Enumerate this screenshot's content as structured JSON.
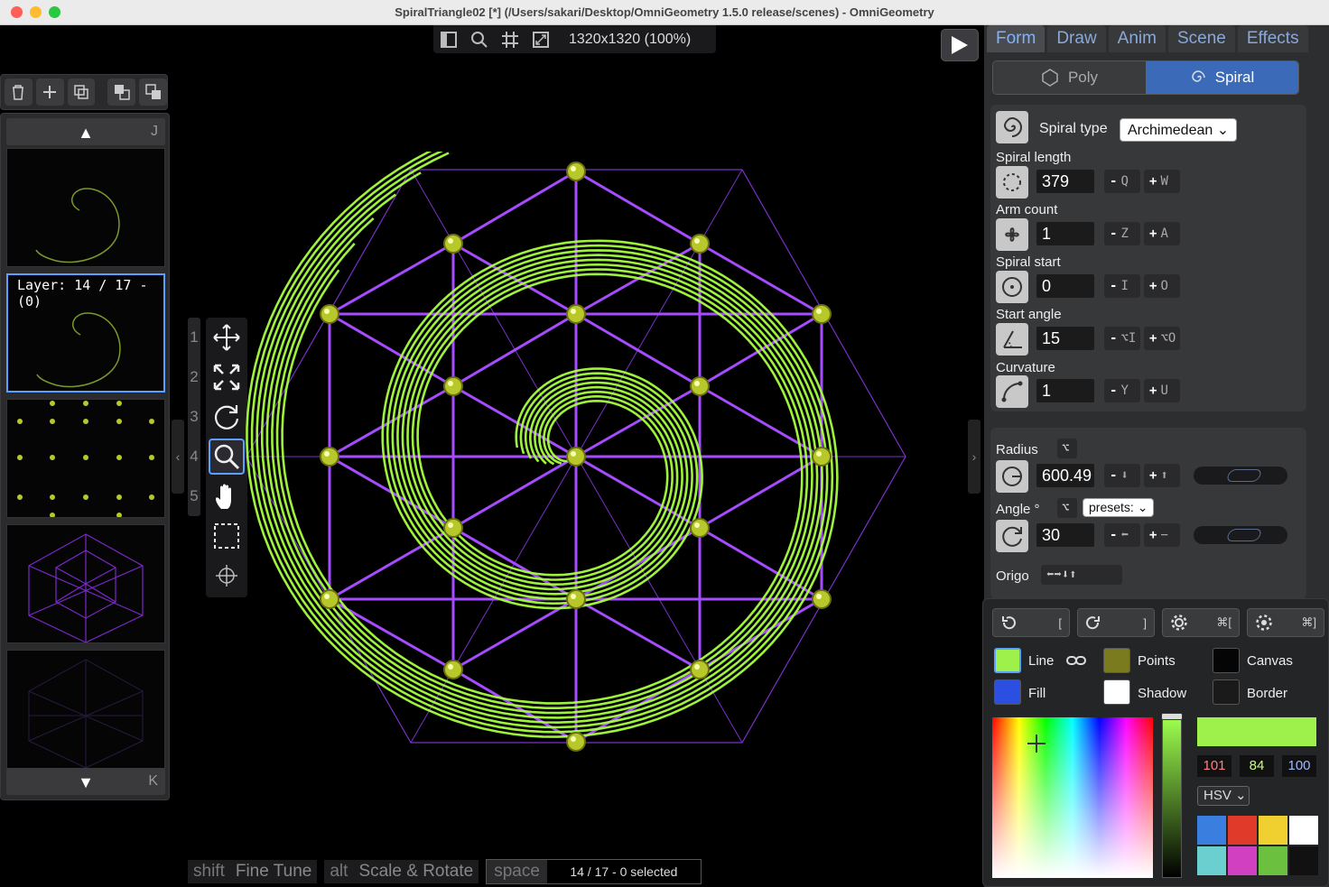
{
  "window": {
    "title": "SpiralTriangle02 [*] (/Users/sakari/Desktop/OmniGeometry 1.5.0 release/scenes) - OmniGeometry"
  },
  "viewbar": {
    "resolution": "1320x1320 (100%)"
  },
  "layers": {
    "up_key": "J",
    "down_key": "K",
    "selected_label": "Layer: 14 / 17 - (0)"
  },
  "tool_numbers": [
    "1",
    "2",
    "3",
    "4",
    "5"
  ],
  "statusbar": {
    "shift_key": "shift",
    "shift_label": "Fine Tune",
    "alt_key": "alt",
    "alt_label": "Scale & Rotate",
    "space_key": "space",
    "selection": "14 / 17 - 0 selected"
  },
  "panel": {
    "tabs": [
      "Form",
      "Draw",
      "Anim",
      "Scene",
      "Effects"
    ],
    "active_tab": "Form",
    "segments": [
      "Poly",
      "Spiral"
    ],
    "active_segment": "Spiral",
    "spiral_type_label": "Spiral type",
    "spiral_type_value": "Archimedean",
    "fields": [
      {
        "label": "Spiral length",
        "value": "379",
        "minus": "Q",
        "plus": "W"
      },
      {
        "label": "Arm count",
        "value": "1",
        "minus": "Z",
        "plus": "A"
      },
      {
        "label": "Spiral start",
        "value": "0",
        "minus": "I",
        "plus": "O"
      },
      {
        "label": "Start angle",
        "value": "15",
        "minus": "⌥I",
        "plus": "⌥O"
      },
      {
        "label": "Curvature",
        "value": "1",
        "minus": "Y",
        "plus": "U"
      }
    ],
    "radius": {
      "label": "Radius",
      "value": "600.49",
      "opt": "⌥"
    },
    "angle": {
      "label": "Angle °",
      "value": "30",
      "opt": "⌥",
      "presets": "presets:"
    },
    "origo": {
      "label": "Origo"
    }
  },
  "colors": {
    "undo_key": "[",
    "redo_key": "]",
    "settings_key": "⌘[",
    "settings2_key": "⌘]",
    "line_label": "Line",
    "fill_label": "Fill",
    "points_label": "Points",
    "shadow_label": "Shadow",
    "canvas_label": "Canvas",
    "border_label": "Border",
    "line_color": "#9ef04a",
    "fill_color": "#2b4fe0",
    "points_color": "#7a7a1e",
    "shadow_color": "#ffffff",
    "canvas_color": "#050505",
    "border_color": "#1a1a1a",
    "hsv": [
      "101",
      "84",
      "100"
    ],
    "mode": "HSV",
    "palette": [
      "#3a7ee0",
      "#e03a2a",
      "#f0d030",
      "#ffffff",
      "#6ccfcf",
      "#d040c0",
      "#6cc040",
      "#111111"
    ]
  },
  "accent": "#9933ff",
  "spiral_color": "#a6ff3f"
}
